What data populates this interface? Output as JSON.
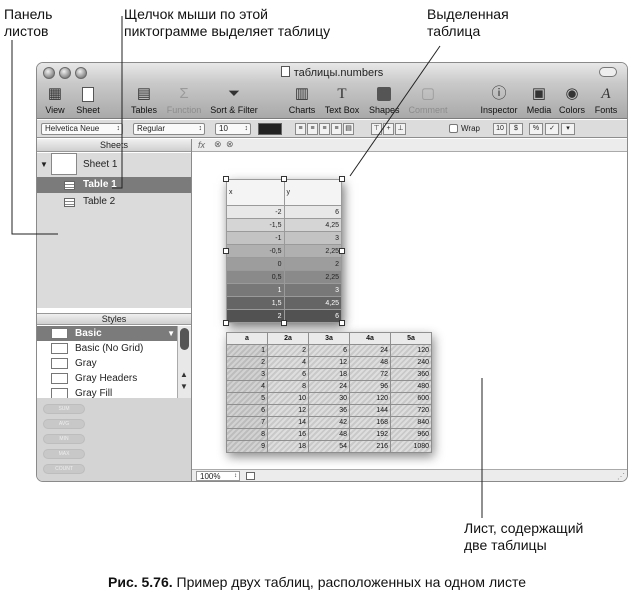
{
  "annotations": {
    "sheets_panel": "Панель\nлистов",
    "icon_click": "Щелчок мыши по этой\nпиктограмме выделяет таблицу",
    "selected_table": "Выделенная\nтаблица",
    "sheet_two_tables": "Лист, содержащий\nдве таблицы"
  },
  "window": {
    "title": "таблицы.numbers"
  },
  "toolbar": {
    "view": "View",
    "sheet": "Sheet",
    "tables": "Tables",
    "function": "Function",
    "sort_filter": "Sort & Filter",
    "charts": "Charts",
    "text_box": "Text Box",
    "shapes": "Shapes",
    "comment": "Comment",
    "inspector": "Inspector",
    "media": "Media",
    "colors": "Colors",
    "fonts": "Fonts"
  },
  "format_bar": {
    "font": "Helvetica Neue",
    "style": "Regular",
    "size": "10",
    "wrap": "Wrap",
    "num_buttons": [
      "10",
      "$",
      "%",
      "✓"
    ]
  },
  "sidebar": {
    "sheets_header": "Sheets",
    "sheet_name": "Sheet 1",
    "tables": [
      "Table 1",
      "Table 2"
    ],
    "styles_header": "Styles",
    "styles": [
      "Basic",
      "Basic (No Grid)",
      "Gray",
      "Gray Headers",
      "Gray Fill"
    ],
    "bottom_buttons": [
      "SUM",
      "AVG",
      "MIN",
      "MAX",
      "COUNT"
    ]
  },
  "status": {
    "zoom": "100%"
  },
  "table1": {
    "headers": [
      "x",
      "y"
    ],
    "rows": [
      [
        "-2",
        "6"
      ],
      [
        "-1,5",
        "4,25"
      ],
      [
        "-1",
        "3"
      ],
      [
        "-0,5",
        "2,25"
      ],
      [
        "0",
        "2"
      ],
      [
        "0,5",
        "2,25"
      ],
      [
        "1",
        "3"
      ],
      [
        "1,5",
        "4,25"
      ],
      [
        "2",
        "6"
      ]
    ]
  },
  "table2": {
    "headers": [
      "a",
      "2a",
      "3a",
      "4a",
      "5a"
    ],
    "rows": [
      [
        "1",
        "2",
        "6",
        "24",
        "120"
      ],
      [
        "2",
        "4",
        "12",
        "48",
        "240"
      ],
      [
        "3",
        "6",
        "18",
        "72",
        "360"
      ],
      [
        "4",
        "8",
        "24",
        "96",
        "480"
      ],
      [
        "5",
        "10",
        "30",
        "120",
        "600"
      ],
      [
        "6",
        "12",
        "36",
        "144",
        "720"
      ],
      [
        "7",
        "14",
        "42",
        "168",
        "840"
      ],
      [
        "8",
        "16",
        "48",
        "192",
        "960"
      ],
      [
        "9",
        "18",
        "54",
        "216",
        "1080"
      ]
    ]
  },
  "caption": {
    "label": "Рис. 5.76.",
    "text": "Пример двух таблиц, расположенных на одном листе"
  }
}
